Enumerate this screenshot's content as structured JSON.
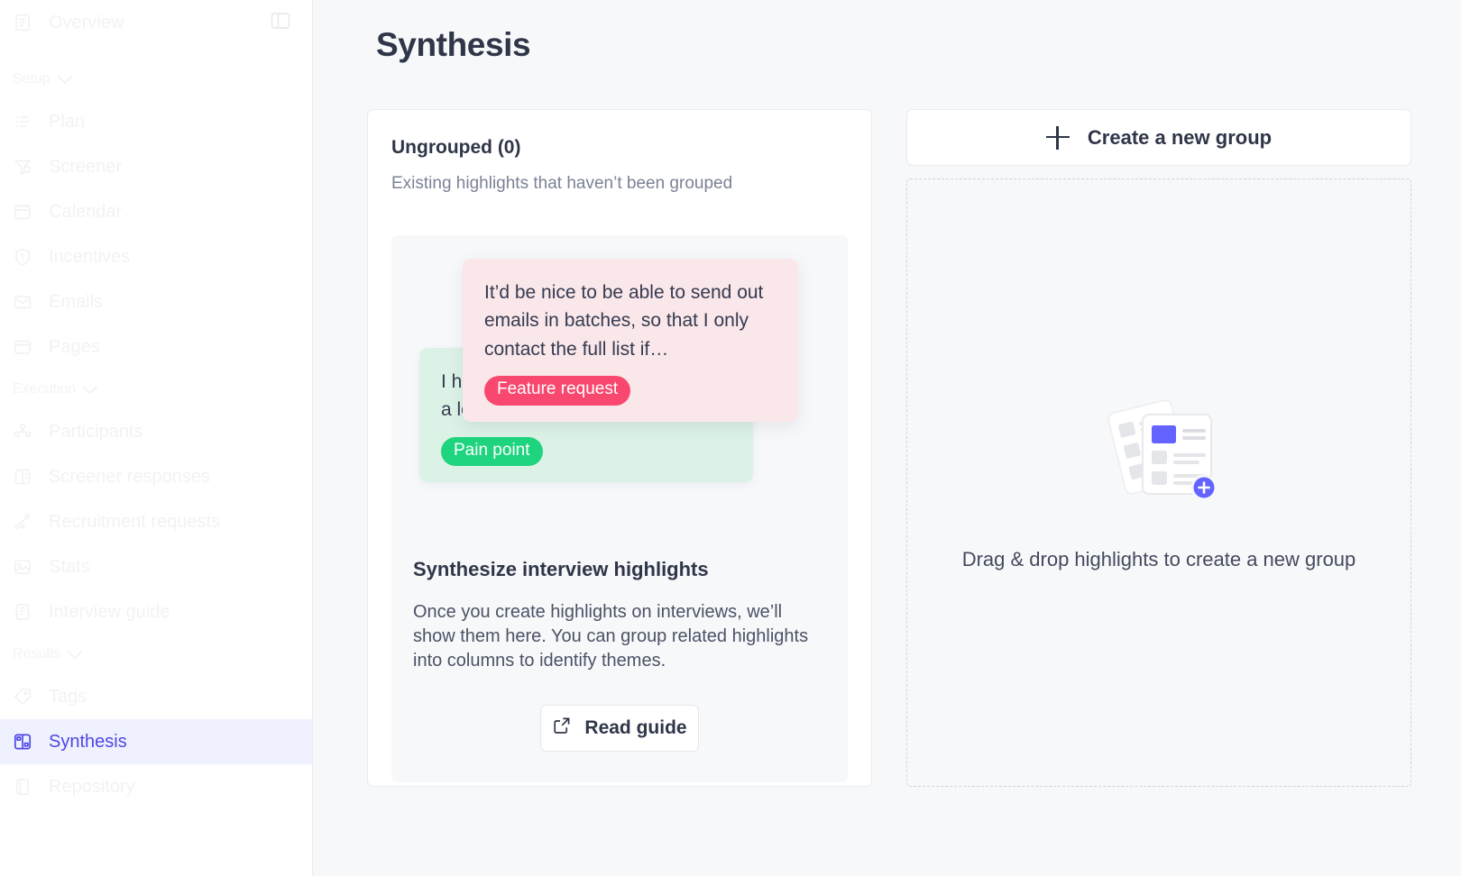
{
  "sidebar": {
    "collapse_icon": "panel-collapse-icon",
    "items": [
      {
        "type": "item",
        "label": "Overview",
        "icon": "file-text-icon",
        "active": false
      },
      {
        "type": "section",
        "label": "Setup",
        "icon": "chevron-down-icon"
      },
      {
        "type": "item",
        "label": "Plan",
        "icon": "list-icon",
        "active": false
      },
      {
        "type": "item",
        "label": "Screener",
        "icon": "filter-funnel-icon",
        "active": false
      },
      {
        "type": "item",
        "label": "Calendar",
        "icon": "calendar-icon",
        "active": false
      },
      {
        "type": "item",
        "label": "Incentives",
        "icon": "shield-icon",
        "active": false
      },
      {
        "type": "item",
        "label": "Emails",
        "icon": "mail-icon",
        "active": false
      },
      {
        "type": "item",
        "label": "Pages",
        "icon": "window-icon",
        "active": false
      },
      {
        "type": "section",
        "label": "Execution",
        "icon": "chevron-down-icon"
      },
      {
        "type": "item",
        "label": "Participants",
        "icon": "users-icon",
        "active": false
      },
      {
        "type": "item",
        "label": "Screener responses",
        "icon": "clipboard-icon",
        "active": false
      },
      {
        "type": "item",
        "label": "Recruitment requests",
        "icon": "share-nodes-icon",
        "active": false
      },
      {
        "type": "item",
        "label": "Stats",
        "icon": "image-chart-icon",
        "active": false
      },
      {
        "type": "item",
        "label": "Interview guide",
        "icon": "notebook-icon",
        "active": false
      },
      {
        "type": "section",
        "label": "Results",
        "icon": "chevron-down-icon"
      },
      {
        "type": "item",
        "label": "Tags",
        "icon": "tag-icon",
        "active": false
      },
      {
        "type": "item",
        "label": "Synthesis",
        "icon": "layout-grid-icon",
        "active": true
      },
      {
        "type": "item",
        "label": "Repository",
        "icon": "database-icon",
        "active": false
      }
    ]
  },
  "page": {
    "title": "Synthesis"
  },
  "ungrouped": {
    "title": "Ungrouped (0)",
    "subtitle": "Existing highlights that haven’t been grouped",
    "highlights": [
      {
        "text": "I ha… the… know the answers to a lot of the required questions,…",
        "tag": "Pain point",
        "tag_color": "#1ed47e",
        "card_color": "#dcf2e6"
      },
      {
        "text": "It’d be nice to be able to send out emails in batches, so that I only contact the full list if…",
        "tag": "Feature request",
        "tag_color": "#f8486f",
        "card_color": "#fae7ea"
      }
    ],
    "promo": {
      "title": "Synthesize interview highlights",
      "body": "Once you create highlights on interviews, we’ll show them here. You can group related highlights into columns to identify themes.",
      "button_label": "Read guide",
      "button_icon": "external-link-icon"
    }
  },
  "new_group": {
    "create_label": "Create a new group",
    "create_icon": "plus-icon",
    "dropzone_text": "Drag & drop highlights to create a new group",
    "dropzone_illustration": "stacked-cards-add-icon"
  },
  "colors": {
    "accent": "#4f46e5",
    "accent_bg": "#eff2fe",
    "page_bg": "#f7f8fa",
    "panel_bg": "#ffffff",
    "border": "#e9ebf0",
    "text": "#2f3648",
    "muted_text": "#7b8296",
    "pain_point": "#1ed47e",
    "feature_request": "#f8486f"
  }
}
